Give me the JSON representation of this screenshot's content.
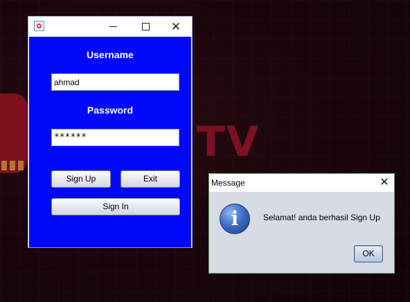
{
  "login_window": {
    "username_label": "Username",
    "username_value": "ahmad",
    "password_label": "Password",
    "password_value": "******",
    "signup_label": "Sign Up",
    "exit_label": "Exit",
    "signin_label": "Sign In",
    "close_glyph": "✕",
    "colors": {
      "panel": "#0008fa",
      "label": "#ffffff"
    }
  },
  "message_dialog": {
    "title": "Message",
    "text": "Selamat! anda berhasil Sign Up",
    "ok_label": "OK",
    "close_glyph": "✕",
    "icon": "information-icon"
  },
  "background": {
    "text": "TV"
  }
}
